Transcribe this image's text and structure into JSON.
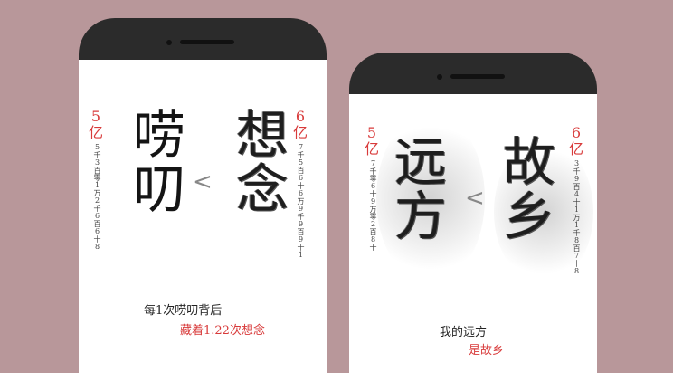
{
  "left": {
    "chars_left": "唠叨",
    "chars_right": "想念",
    "label_left": "5亿",
    "label_right": "6亿",
    "digits_left": "5千3百零1万2千6百6十8",
    "digits_right": "7千5百6十6万9千9百9十1",
    "comparator": "<",
    "caption_line1": "每1次唠叨背后",
    "caption_line2": "藏着1.22次想念"
  },
  "right": {
    "chars_left": "远方",
    "chars_right": "故乡",
    "label_left": "5亿",
    "label_right": "6亿",
    "digits_left": "7千零6十9万零2百8十",
    "digits_right": "3千9百4十1万1千8百7十8",
    "comparator": "<",
    "caption_line1": "我的远方",
    "caption_line2": "是故乡"
  }
}
